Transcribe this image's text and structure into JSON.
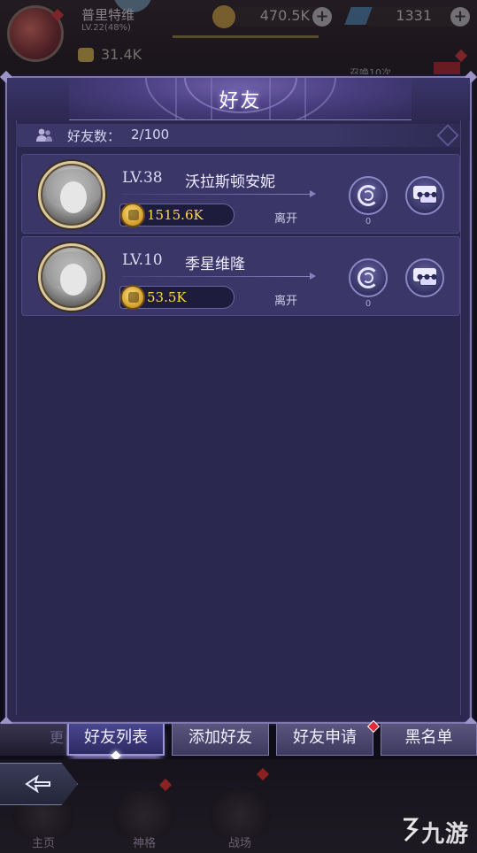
{
  "topbar": {
    "player_name": "普里特维",
    "player_level": "LV.22(48%)",
    "gold": "470.5K",
    "diamonds": "1331",
    "power": "31.4K",
    "summon_hint": "召唤10次"
  },
  "panel": {
    "title": "好友",
    "friend_count_label": "好友数：",
    "friend_count_value": "2/100"
  },
  "friends": [
    {
      "level": "LV.38",
      "name": "沃拉斯顿安妮",
      "power": "1515.6K",
      "status": "离开",
      "gift_count": "0"
    },
    {
      "level": "LV.10",
      "name": "季星维隆",
      "power": "53.5K",
      "status": "离开",
      "gift_count": "0"
    }
  ],
  "tabs": {
    "partial_left": "更",
    "friend_list": "好友列表",
    "add_friend": "添加好友",
    "friend_requests": "好友申请",
    "blacklist": "黑名单"
  },
  "bottom_nav": {
    "home": "主页",
    "divinity": "神格",
    "battle": "战场"
  },
  "watermark": "九游",
  "colors": {
    "panel_bg": "#2c2850",
    "card_bg": "#3a3768",
    "power_text": "#ffd84a",
    "notification_red": "#e02a3a"
  }
}
